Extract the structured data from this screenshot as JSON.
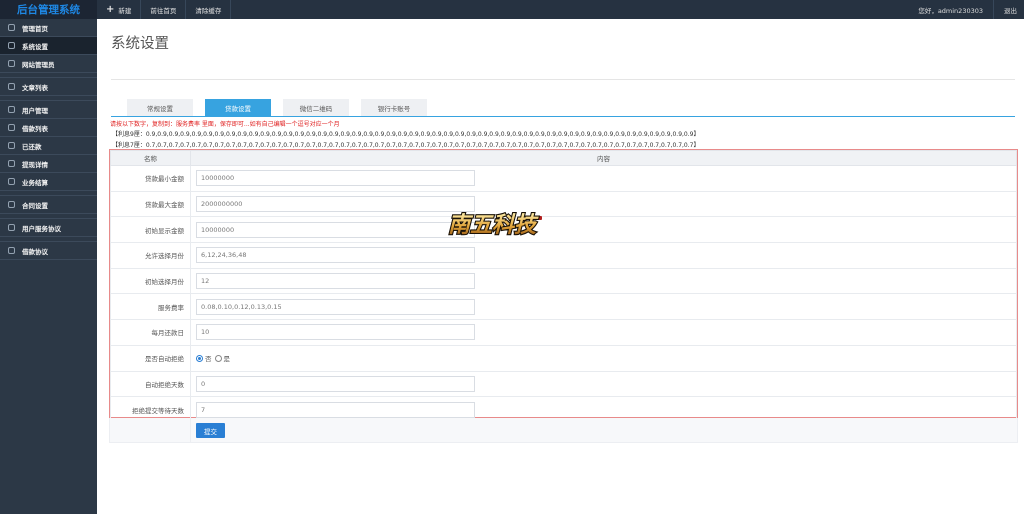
{
  "app_title": "后台管理系统",
  "toolbar": {
    "new_label": "新建",
    "home_label": "前往首页",
    "clear_cache_label": "清除缓存",
    "greeting": "您好，admin230303",
    "logout_label": "退出"
  },
  "sidebar": {
    "items": [
      {
        "label": "管理首页"
      },
      {
        "label": "系统设置"
      },
      {
        "label": "网站管理员"
      },
      {
        "label": "文章列表"
      },
      {
        "label": "用户管理"
      },
      {
        "label": "借款列表"
      },
      {
        "label": "已还款"
      },
      {
        "label": "提现详情"
      },
      {
        "label": "业务结算"
      },
      {
        "label": "合同设置"
      },
      {
        "label": "用户服务协议"
      },
      {
        "label": "借款协议"
      }
    ]
  },
  "page": {
    "title": "系统设置",
    "tabs": [
      {
        "label": "常规设置"
      },
      {
        "label": "贷款设置",
        "active": true
      },
      {
        "label": "微信二维码"
      },
      {
        "label": "银行卡账号"
      }
    ],
    "hint": "请按以下数字，复制到：服务费率 里面，保存即可...如有自己编辑一个逗号对应一个月",
    "ratio_9": "【利息9厘：0.9,0.9,0.9,0.9,0.9,0.9,0.9,0.9,0.9,0.9,0.9,0.9,0.9,0.9,0.9,0.9,0.9,0.9,0.9,0.9,0.9,0.9,0.9,0.9,0.9,0.9,0.9,0.9,0.9,0.9,0.9,0.9,0.9,0.9,0.9,0.9,0.9,0.9,0.9,0.9,0.9,0.9,0.9,0.9,0.9,0.9,0.9,0.9】",
    "ratio_7": "【利息7厘：0.7,0.7,0.7,0.7,0.7,0.7,0.7,0.7,0.7,0.7,0.7,0.7,0.7,0.7,0.7,0.7,0.7,0.7,0.7,0.7,0.7,0.7,0.7,0.7,0.7,0.7,0.7,0.7,0.7,0.7,0.7,0.7,0.7,0.7,0.7,0.7,0.7,0.7,0.7,0.7,0.7,0.7,0.7,0.7,0.7,0.7,0.7,0.7】",
    "table_headers": {
      "name": "名称",
      "content": "内容"
    },
    "fields": {
      "min_amount": {
        "label": "贷款最小金额",
        "value": "10000000"
      },
      "max_amount": {
        "label": "贷款最大金额",
        "value": "2000000000"
      },
      "init_amount": {
        "label": "初始显示金额",
        "value": "10000000"
      },
      "allowed_months": {
        "label": "允许选择月份",
        "value": "6,12,24,36,48"
      },
      "init_month": {
        "label": "初始选择月份",
        "value": "12"
      },
      "service_rate": {
        "label": "服务费率",
        "value": "0.08,0.10,0.12,0.13,0.15"
      },
      "repay_day": {
        "label": "每月还款日",
        "value": "10"
      },
      "auto_reject": {
        "label": "是否自动拒绝",
        "option_no": "否",
        "option_yes": "是",
        "selected": "否"
      },
      "auto_reject_days": {
        "label": "自动拒绝天数",
        "value": "0"
      },
      "reject_wait_days": {
        "label": "拒绝提交等待天数",
        "value": "7"
      }
    },
    "submit_label": "提交"
  },
  "watermark": {
    "text": "南五科技"
  },
  "colors": {
    "topbar": "#263241",
    "sidebar": "#2c3846",
    "brand_text": "#1e88e5",
    "accent": "#37a3e0",
    "button": "#2a7fd4",
    "hint_red": "#e02020",
    "form_border": "#e88a8a"
  },
  "icons": {
    "new": "plus-icon",
    "nav": "square-outline-icon"
  }
}
